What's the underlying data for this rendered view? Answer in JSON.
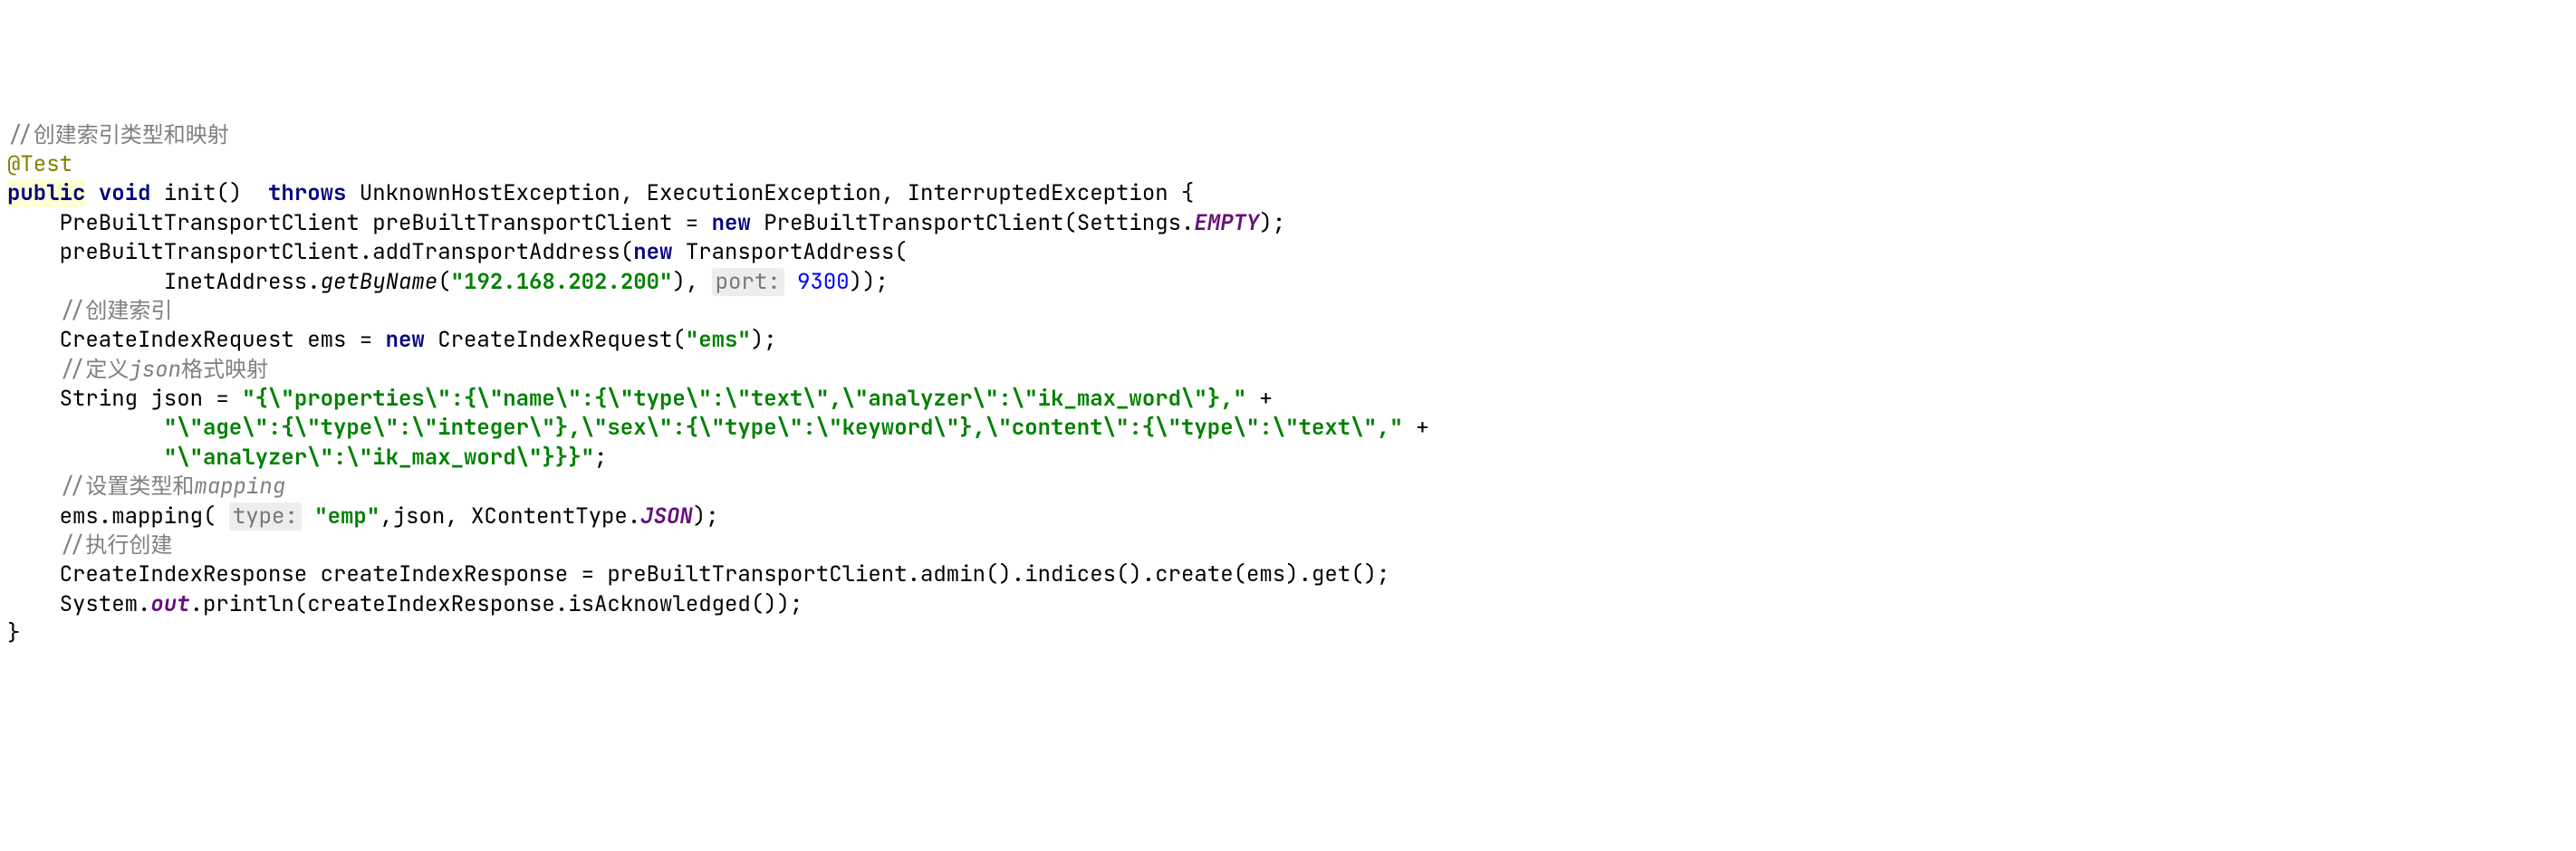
{
  "code": {
    "lines": [
      {
        "type": "comment",
        "indent": 0,
        "text": "//创建索引类型和映射"
      },
      {
        "type": "annotation",
        "indent": 0,
        "text": "@Test"
      },
      {
        "type": "method-sig",
        "indent": 0,
        "parts": {
          "public": "public",
          "void": "void",
          "name": " init()  ",
          "throws": "throws",
          "exceptions": " UnknownHostException, ExecutionException, InterruptedException {"
        }
      },
      {
        "type": "code",
        "indent": 1,
        "parts": [
          {
            "class": "plain",
            "text": "PreBuiltTransportClient preBuiltTransportClient = "
          },
          {
            "class": "keyword",
            "text": "new"
          },
          {
            "class": "plain",
            "text": " PreBuiltTransportClient(Settings."
          },
          {
            "class": "static-field",
            "text": "EMPTY"
          },
          {
            "class": "plain",
            "text": ");"
          }
        ]
      },
      {
        "type": "code",
        "indent": 1,
        "parts": [
          {
            "class": "plain",
            "text": "preBuiltTransportClient.addTransportAddress("
          },
          {
            "class": "keyword",
            "text": "new"
          },
          {
            "class": "plain",
            "text": " TransportAddress("
          }
        ]
      },
      {
        "type": "code",
        "indent": 3,
        "parts": [
          {
            "class": "plain",
            "text": "InetAddress."
          },
          {
            "class": "static-method",
            "text": "getByName"
          },
          {
            "class": "plain",
            "text": "("
          },
          {
            "class": "string",
            "text": "\"192.168.202.200\""
          },
          {
            "class": "plain",
            "text": "), "
          },
          {
            "class": "param-hint",
            "text": "port:"
          },
          {
            "class": "plain",
            "text": " "
          },
          {
            "class": "number",
            "text": "9300"
          },
          {
            "class": "plain",
            "text": "));"
          }
        ]
      },
      {
        "type": "comment",
        "indent": 1,
        "text": "//创建索引"
      },
      {
        "type": "code",
        "indent": 1,
        "parts": [
          {
            "class": "plain",
            "text": "CreateIndexRequest ems = "
          },
          {
            "class": "keyword",
            "text": "new"
          },
          {
            "class": "plain",
            "text": " CreateIndexRequest("
          },
          {
            "class": "string",
            "text": "\"ems\""
          },
          {
            "class": "plain",
            "text": ");"
          }
        ]
      },
      {
        "type": "comment-mixed",
        "indent": 1,
        "pre": "//定义",
        "italic": "json",
        "post": "格式映射"
      },
      {
        "type": "code",
        "indent": 1,
        "parts": [
          {
            "class": "plain",
            "text": "String json = "
          },
          {
            "class": "string",
            "text": "\"{\\\"properties\\\":{\\\"name\\\":{\\\"type\\\":\\\"text\\\",\\\"analyzer\\\":\\\"ik_max_word\\\"},\""
          },
          {
            "class": "plain",
            "text": " +"
          }
        ]
      },
      {
        "type": "code",
        "indent": 3,
        "parts": [
          {
            "class": "string",
            "text": "\"\\\"age\\\":{\\\"type\\\":\\\"integer\\\"},\\\"sex\\\":{\\\"type\\\":\\\"keyword\\\"},\\\"content\\\":{\\\"type\\\":\\\"text\\\",\""
          },
          {
            "class": "plain",
            "text": " +"
          }
        ]
      },
      {
        "type": "code",
        "indent": 3,
        "parts": [
          {
            "class": "string",
            "text": "\"\\\"analyzer\\\":\\\"ik_max_word\\\"}}}\""
          },
          {
            "class": "plain",
            "text": ";"
          }
        ]
      },
      {
        "type": "comment-mixed",
        "indent": 1,
        "pre": "//设置类型和",
        "italic": "mapping",
        "post": ""
      },
      {
        "type": "code",
        "indent": 1,
        "parts": [
          {
            "class": "plain",
            "text": "ems.mapping( "
          },
          {
            "class": "param-hint",
            "text": "type:"
          },
          {
            "class": "plain",
            "text": " "
          },
          {
            "class": "string",
            "text": "\"emp\""
          },
          {
            "class": "plain",
            "text": ",json, XContentType."
          },
          {
            "class": "static-field",
            "text": "JSON"
          },
          {
            "class": "plain",
            "text": ");"
          }
        ]
      },
      {
        "type": "comment",
        "indent": 1,
        "text": "//执行创建"
      },
      {
        "type": "code",
        "indent": 1,
        "parts": [
          {
            "class": "plain",
            "text": "CreateIndexResponse createIndexResponse = preBuiltTransportClient.admin().indices().create(ems).get();"
          }
        ]
      },
      {
        "type": "code",
        "indent": 1,
        "parts": [
          {
            "class": "plain",
            "text": "System."
          },
          {
            "class": "static-field",
            "text": "out"
          },
          {
            "class": "plain",
            "text": ".println(createIndexResponse.isAcknowledged());"
          }
        ]
      },
      {
        "type": "plain",
        "indent": 0,
        "text": "}"
      }
    ]
  }
}
